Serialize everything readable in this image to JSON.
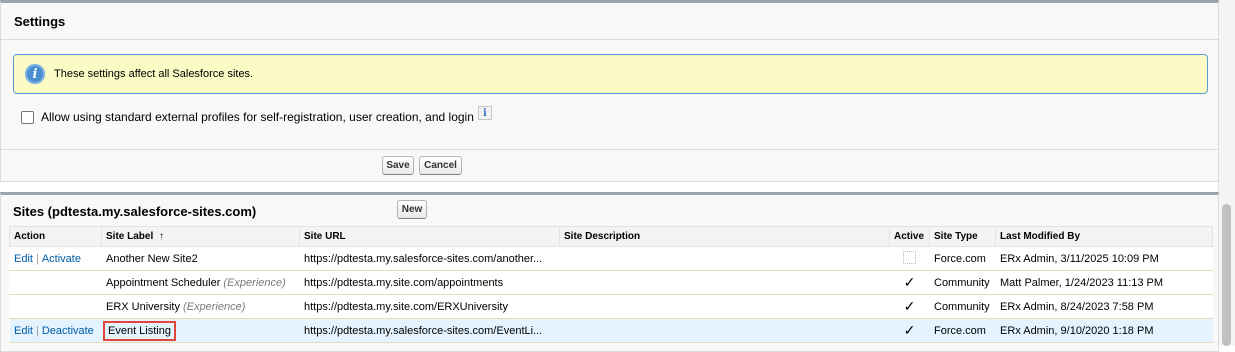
{
  "settings": {
    "title": "Settings",
    "info_text": "These settings affect all Salesforce sites.",
    "checkbox_label": "Allow using standard external profiles for self-registration, user creation, and login",
    "help_icon_glyph": "i",
    "save_label": "Save",
    "cancel_label": "Cancel"
  },
  "sites": {
    "title": "Sites (pdtesta.my.salesforce-sites.com)",
    "new_label": "New",
    "headers": {
      "action": "Action",
      "site_label": "Site Label",
      "sort_arrow": "↑",
      "site_url": "Site URL",
      "site_description": "Site Description",
      "active": "Active",
      "site_type": "Site Type",
      "last_modified_by": "Last Modified By"
    },
    "rows": [
      {
        "edit": "Edit",
        "sep": "|",
        "toggle": "Activate",
        "label": "Another New Site2",
        "tag": "",
        "url": "https://pdtesta.my.salesforce-sites.com/another...",
        "description": "",
        "active": false,
        "type": "Force.com",
        "modified": "ERx Admin, 3/11/2025 10:09 PM"
      },
      {
        "edit": "",
        "sep": "",
        "toggle": "",
        "label": "Appointment Scheduler",
        "tag": "(Experience)",
        "url": "https://pdtesta.my.site.com/appointments",
        "description": "",
        "active": true,
        "type": "Community",
        "modified": "Matt Palmer, 1/24/2023 11:13 PM"
      },
      {
        "edit": "",
        "sep": "",
        "toggle": "",
        "label": "ERX University",
        "tag": "(Experience)",
        "url": "https://pdtesta.my.site.com/ERXUniversity",
        "description": "",
        "active": true,
        "type": "Community",
        "modified": "ERx Admin, 8/24/2023 7:58 PM"
      },
      {
        "edit": "Edit",
        "sep": "|",
        "toggle": "Deactivate",
        "label": "Event Listing",
        "tag": "",
        "url": "https://pdtesta.my.salesforce-sites.com/EventLi...",
        "description": "",
        "active": true,
        "type": "Force.com",
        "modified": "ERx Admin, 9/10/2020 1:18 PM"
      }
    ]
  },
  "colors": {
    "link": "#015ba7",
    "info_bg": "#fbfbc5",
    "highlight_row": "#e3f3ff",
    "highlight_box": "#e0443d"
  }
}
